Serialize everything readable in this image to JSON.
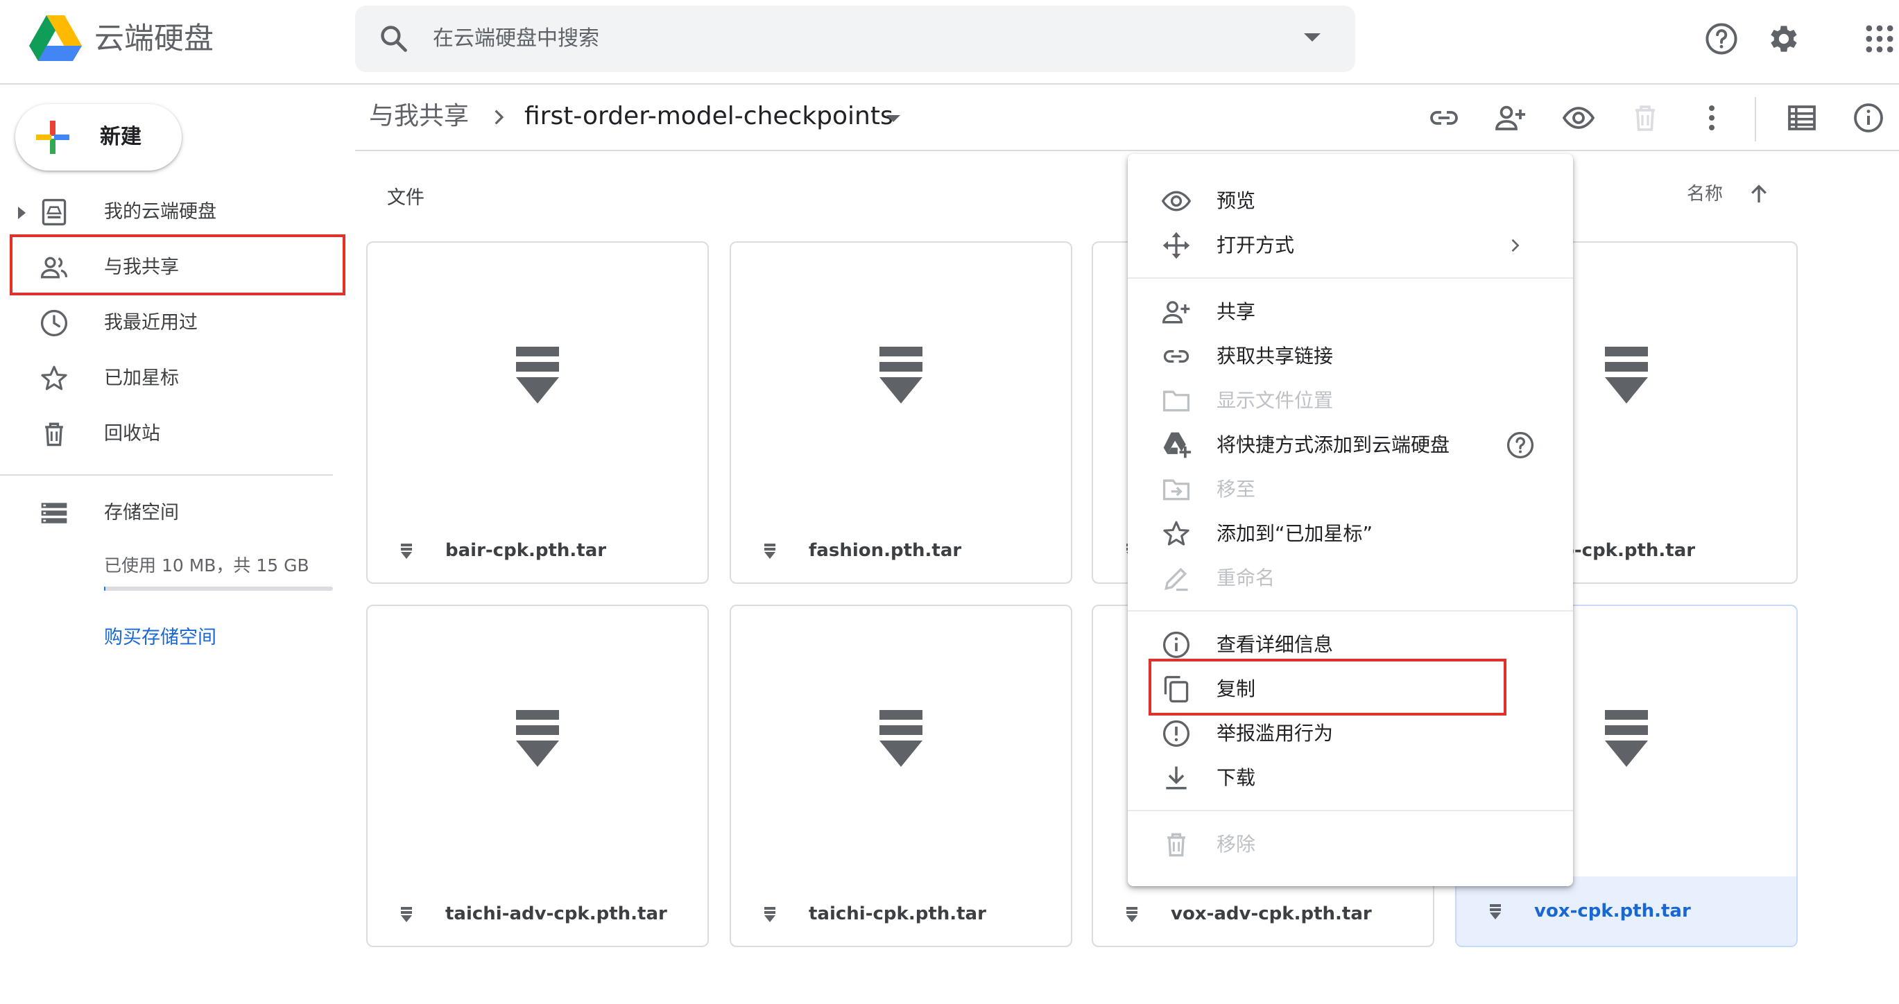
{
  "app": {
    "title": "云端硬盘"
  },
  "search": {
    "placeholder": "在云端硬盘中搜索"
  },
  "header_icons": [
    "help-icon",
    "settings-icon",
    "apps-grid-icon"
  ],
  "sidebar": {
    "new_label": "新建",
    "items": [
      {
        "label": "我的云端硬盘",
        "icon": "my-drive-icon"
      },
      {
        "label": "与我共享",
        "icon": "shared-with-me-icon"
      },
      {
        "label": "我最近用过",
        "icon": "recent-clock-icon"
      },
      {
        "label": "已加星标",
        "icon": "star-icon"
      },
      {
        "label": "回收站",
        "icon": "trash-icon"
      }
    ],
    "storage": {
      "label": "存储空间",
      "used_text": "已使用 10 MB，共 15 GB",
      "used_fraction": 0.001,
      "buy_label": "购买存储空间"
    }
  },
  "breadcrumb": {
    "root": "与我共享",
    "current": "first-order-model-checkpoints"
  },
  "toolbar_icons": [
    "link-icon",
    "add-person-icon",
    "preview-eye-icon",
    "trash-icon",
    "more-vert-icon",
    "list-view-icon",
    "info-icon"
  ],
  "content": {
    "heading": "文件",
    "sort_label": "名称",
    "files": [
      {
        "name": "bair-cpk.pth.tar"
      },
      {
        "name": "fashion.pth.tar"
      },
      {
        "name": ""
      },
      {
        "name": "o-cpk.pth.tar"
      },
      {
        "name": "taichi-adv-cpk.pth.tar"
      },
      {
        "name": "taichi-cpk.pth.tar"
      },
      {
        "name": "vox-adv-cpk.pth.tar"
      },
      {
        "name": "vox-cpk.pth.tar",
        "selected": true
      }
    ]
  },
  "context_menu": {
    "items": [
      {
        "label": "预览",
        "icon": "preview-eye-icon",
        "enabled": true
      },
      {
        "label": "打开方式",
        "icon": "open-with-icon",
        "enabled": true,
        "submenu": true
      },
      {
        "label": "共享",
        "icon": "add-person-icon",
        "enabled": true
      },
      {
        "label": "获取共享链接",
        "icon": "link-icon",
        "enabled": true
      },
      {
        "label": "显示文件位置",
        "icon": "folder-icon",
        "enabled": false
      },
      {
        "label": "将快捷方式添加到云端硬盘",
        "icon": "add-shortcut-icon",
        "enabled": true,
        "help": true
      },
      {
        "label": "移至",
        "icon": "move-to-icon",
        "enabled": false
      },
      {
        "label": "添加到“已加星标”",
        "icon": "star-icon",
        "enabled": true
      },
      {
        "label": "重命名",
        "icon": "rename-pencil-icon",
        "enabled": false
      },
      {
        "label": "查看详细信息",
        "icon": "info-icon",
        "enabled": true
      },
      {
        "label": "复制",
        "icon": "copy-icon",
        "enabled": true
      },
      {
        "label": "举报滥用行为",
        "icon": "report-icon",
        "enabled": true
      },
      {
        "label": "下载",
        "icon": "download-icon",
        "enabled": true
      },
      {
        "label": "移除",
        "icon": "trash-icon",
        "enabled": false
      }
    ]
  },
  "colors": {
    "accent_blue": "#1a73e8",
    "highlight_red": "#e0312a",
    "icon_gray": "#5f6368",
    "disabled_gray": "#bdc1c6",
    "selected_bg": "#e8f0fe"
  }
}
